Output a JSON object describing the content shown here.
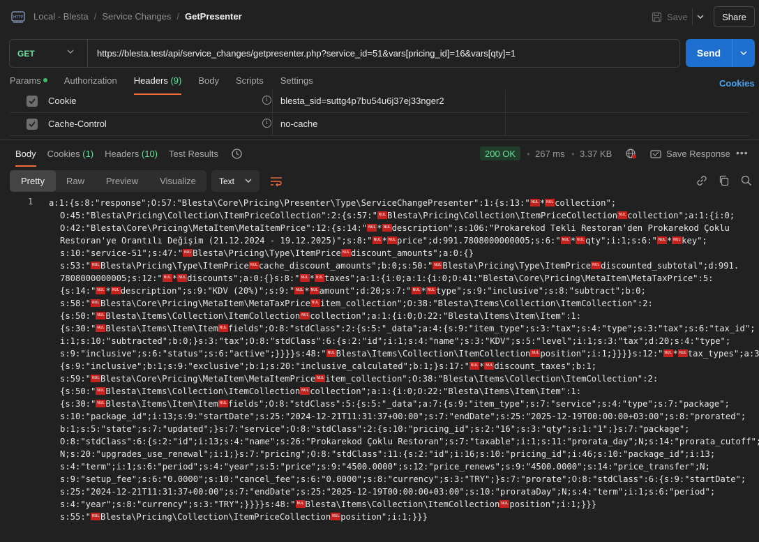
{
  "breadcrumb": {
    "items": [
      "Local - Blesta",
      "Service Changes"
    ],
    "current": "GetPresenter"
  },
  "toolbar": {
    "save_label": "Save",
    "share_label": "Share"
  },
  "request": {
    "method": "GET",
    "url": "https://blesta.test/api/service_changes/getpresenter.php?service_id=51&vars[pricing_id]=16&vars[qty]=1",
    "send_label": "Send"
  },
  "request_tabs": {
    "params": "Params",
    "authorization": "Authorization",
    "headers": "Headers",
    "headers_count": "(9)",
    "body": "Body",
    "scripts": "Scripts",
    "settings": "Settings",
    "cookies_link": "Cookies"
  },
  "headers_rows": [
    {
      "key": "Cookie",
      "value": "blesta_sid=suttg4p7bu54u6j37ej33nger2"
    },
    {
      "key": "Cache-Control",
      "value": "no-cache"
    }
  ],
  "response_tabs": {
    "body": "Body",
    "cookies": "Cookies",
    "cookies_count": "(1)",
    "headers": "Headers",
    "headers_count": "(10)",
    "test_results": "Test Results"
  },
  "response_meta": {
    "status": "200 OK",
    "time": "267 ms",
    "size": "3.37 KB",
    "save_response": "Save Response"
  },
  "view": {
    "options": [
      "Pretty",
      "Raw",
      "Preview",
      "Visualize"
    ],
    "selected": "Pretty",
    "format": "Text"
  },
  "code": {
    "line_number": "1",
    "lines": [
      "a:1:{s:8:\"response\";O:57:\"Blesta\\Core\\Pricing\\Presenter\\Type\\ServiceChangePresenter\":1:{s:13:\"\u0000*\u0000collection\";",
      "O:45:\"Blesta\\Pricing\\Collection\\ItemPriceCollection\":2:{s:57:\"\u0000Blesta\\Pricing\\Collection\\ItemPriceCollection\u0000collection\";a:1:{i:0;",
      "O:42:\"Blesta\\Core\\Pricing\\MetaItem\\MetaItemPrice\":12:{s:14:\"\u0000*\u0000description\";s:106:\"Prokarekod Tekli Restoran'den Prokarekod Çoklu",
      "Restoran'ye Orantılı Değişim (21.12.2024 - 19.12.2025)\";s:8:\"\u0000*\u0000price\";d:991.7808000000005;s:6:\"\u0000*\u0000qty\";i:1;s:6:\"\u0000*\u0000key\";",
      "s:10:\"service-51\";s:47:\"\u0000Blesta\\Pricing\\Type\\ItemPrice\u0000discount_amounts\";a:0:{}",
      "s:53:\"\u0000Blesta\\Pricing\\Type\\ItemPrice\u0000cache_discount_amounts\";b:0;s:50:\"\u0000Blesta\\Pricing\\Type\\ItemPrice\u0000discounted_subtotal\";d:991.",
      "7808000000005;s:12:\"\u0000*\u0000discounts\";a:0:{}s:8:\"\u0000*\u0000taxes\";a:1:{i:0;a:1:{i:0;O:41:\"Blesta\\Core\\Pricing\\MetaItem\\MetaTaxPrice\":5:",
      "{s:14:\"\u0000*\u0000description\";s:9:\"KDV (20%)\";s:9:\"\u0000*\u0000amount\";d:20;s:7:\"\u0000*\u0000type\";s:9:\"inclusive\";s:8:\"subtract\";b:0;",
      "s:58:\"\u0000Blesta\\Core\\Pricing\\MetaItem\\MetaTaxPrice\u0000item_collection\";O:38:\"Blesta\\Items\\Collection\\ItemCollection\":2:",
      "{s:50:\"\u0000Blesta\\Items\\Collection\\ItemCollection\u0000collection\";a:1:{i:0;O:22:\"Blesta\\Items\\Item\\Item\":1:",
      "{s:30:\"\u0000Blesta\\Items\\Item\\Item\u0000fields\";O:8:\"stdClass\":2:{s:5:\"_data\";a:4:{s:9:\"item_type\";s:3:\"tax\";s:4:\"type\";s:3:\"tax\";s:6:\"tax_id\";",
      "i:1;s:10:\"subtracted\";b:0;}s:3:\"tax\";O:8:\"stdClass\":6:{s:2:\"id\";i:1;s:4:\"name\";s:3:\"KDV\";s:5:\"level\";i:1;s:3:\"tax\";d:20;s:4:\"type\";",
      "s:9:\"inclusive\";s:6:\"status\";s:6:\"active\";}}}}s:48:\"\u0000Blesta\\Items\\Collection\\ItemCollection\u0000position\";i:1;}}}}s:12:\"\u0000*\u0000tax_types\";a:3:",
      "{s:9:\"inclusive\";b:1;s:9:\"exclusive\";b:1;s:20:\"inclusive_calculated\";b:1;}s:17:\"\u0000*\u0000discount_taxes\";b:1;",
      "s:59:\"\u0000Blesta\\Core\\Pricing\\MetaItem\\MetaItemPrice\u0000item_collection\";O:38:\"Blesta\\Items\\Collection\\ItemCollection\":2:",
      "{s:50:\"\u0000Blesta\\Items\\Collection\\ItemCollection\u0000collection\";a:1:{i:0;O:22:\"Blesta\\Items\\Item\\Item\":1:",
      "{s:30:\"\u0000Blesta\\Items\\Item\\Item\u0000fields\";O:8:\"stdClass\":5:{s:5:\"_data\";a:7:{s:9:\"item_type\";s:7:\"service\";s:4:\"type\";s:7:\"package\";",
      "s:10:\"package_id\";i:13;s:9:\"startDate\";s:25:\"2024-12-21T11:31:37+00:00\";s:7:\"endDate\";s:25:\"2025-12-19T00:00:00+03:00\";s:8:\"prorated\";",
      "b:1;s:5:\"state\";s:7:\"updated\";}s:7:\"service\";O:8:\"stdClass\":2:{s:10:\"pricing_id\";s:2:\"16\";s:3:\"qty\";s:1:\"1\";}s:7:\"package\";",
      "O:8:\"stdClass\":6:{s:2:\"id\";i:13;s:4:\"name\";s:26:\"Prokarekod Çoklu Restoran\";s:7:\"taxable\";i:1;s:11:\"prorata_day\";N;s:14:\"prorata_cutoff\";",
      "N;s:20:\"upgrades_use_renewal\";i:1;}s:7:\"pricing\";O:8:\"stdClass\":11:{s:2:\"id\";i:16;s:10:\"pricing_id\";i:46;s:10:\"package_id\";i:13;",
      "s:4:\"term\";i:1;s:6:\"period\";s:4:\"year\";s:5:\"price\";s:9:\"4500.0000\";s:12:\"price_renews\";s:9:\"4500.0000\";s:14:\"price_transfer\";N;",
      "s:9:\"setup_fee\";s:6:\"0.0000\";s:10:\"cancel_fee\";s:6:\"0.0000\";s:8:\"currency\";s:3:\"TRY\";}s:7:\"prorate\";O:8:\"stdClass\":6:{s:9:\"startDate\";",
      "s:25:\"2024-12-21T11:31:37+00:00\";s:7:\"endDate\";s:25:\"2025-12-19T00:00:00+03:00\";s:10:\"prorataDay\";N;s:4:\"term\";i:1;s:6:\"period\";",
      "s:4:\"year\";s:8:\"currency\";s:3:\"TRY\";}}}}s:48:\"\u0000Blesta\\Items\\Collection\\ItemCollection\u0000position\";i:1;}}}",
      "s:55:\"\u0000Blesta\\Pricing\\Collection\\ItemPriceCollection\u0000position\";i:1;}}}"
    ]
  },
  "colors": {
    "accent_tab": "#f26b3a",
    "send_button": "#1f6fd1",
    "method_get": "#6bdd9a",
    "status_ok_text": "#6bdd9a",
    "nul_marker": "#c4221f",
    "link": "#4aa3f0"
  }
}
